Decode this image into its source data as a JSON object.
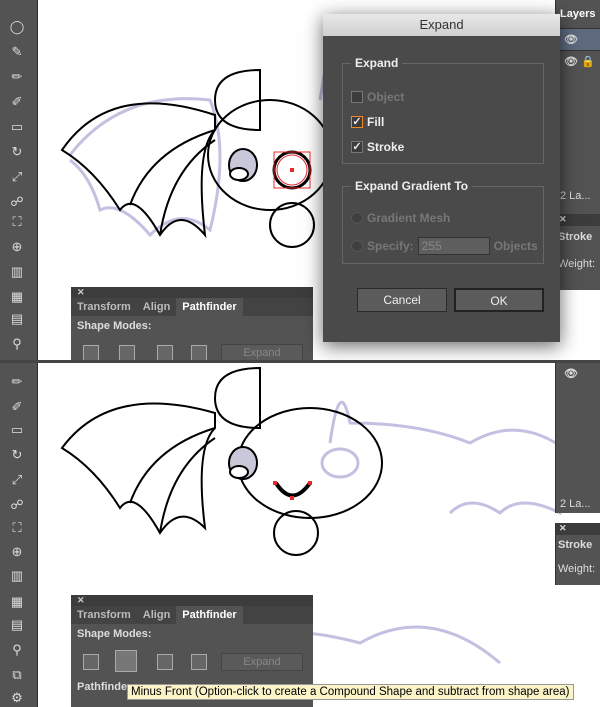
{
  "dialog": {
    "title": "Expand",
    "expand_group": "Expand",
    "object": "Object",
    "fill": "Fill",
    "stroke": "Stroke",
    "gradient_group": "Expand Gradient To",
    "gradient_mesh": "Gradient Mesh",
    "specify": "Specify:",
    "specify_value": "255",
    "objects": "Objects",
    "cancel": "Cancel",
    "ok": "OK",
    "fill_checked": true,
    "stroke_checked": true,
    "object_checked": false
  },
  "layers": {
    "title": "Layers",
    "count": "2 La...",
    "stroke": "Stroke",
    "weight": "Weight:"
  },
  "pathfinder": {
    "tabs": [
      "Transform",
      "Align",
      "Pathfinder"
    ],
    "shape_modes": "Shape Modes:",
    "expand": "Expand",
    "pathfinders": "Pathfinders:"
  },
  "tooltip": "Minus Front (Option-click to create a Compound Shape and subtract from shape area)",
  "colors": {
    "panel": "#535353",
    "selection": "#e8282b",
    "sketch": "#8a86c0",
    "highlight": "#f08a24"
  }
}
